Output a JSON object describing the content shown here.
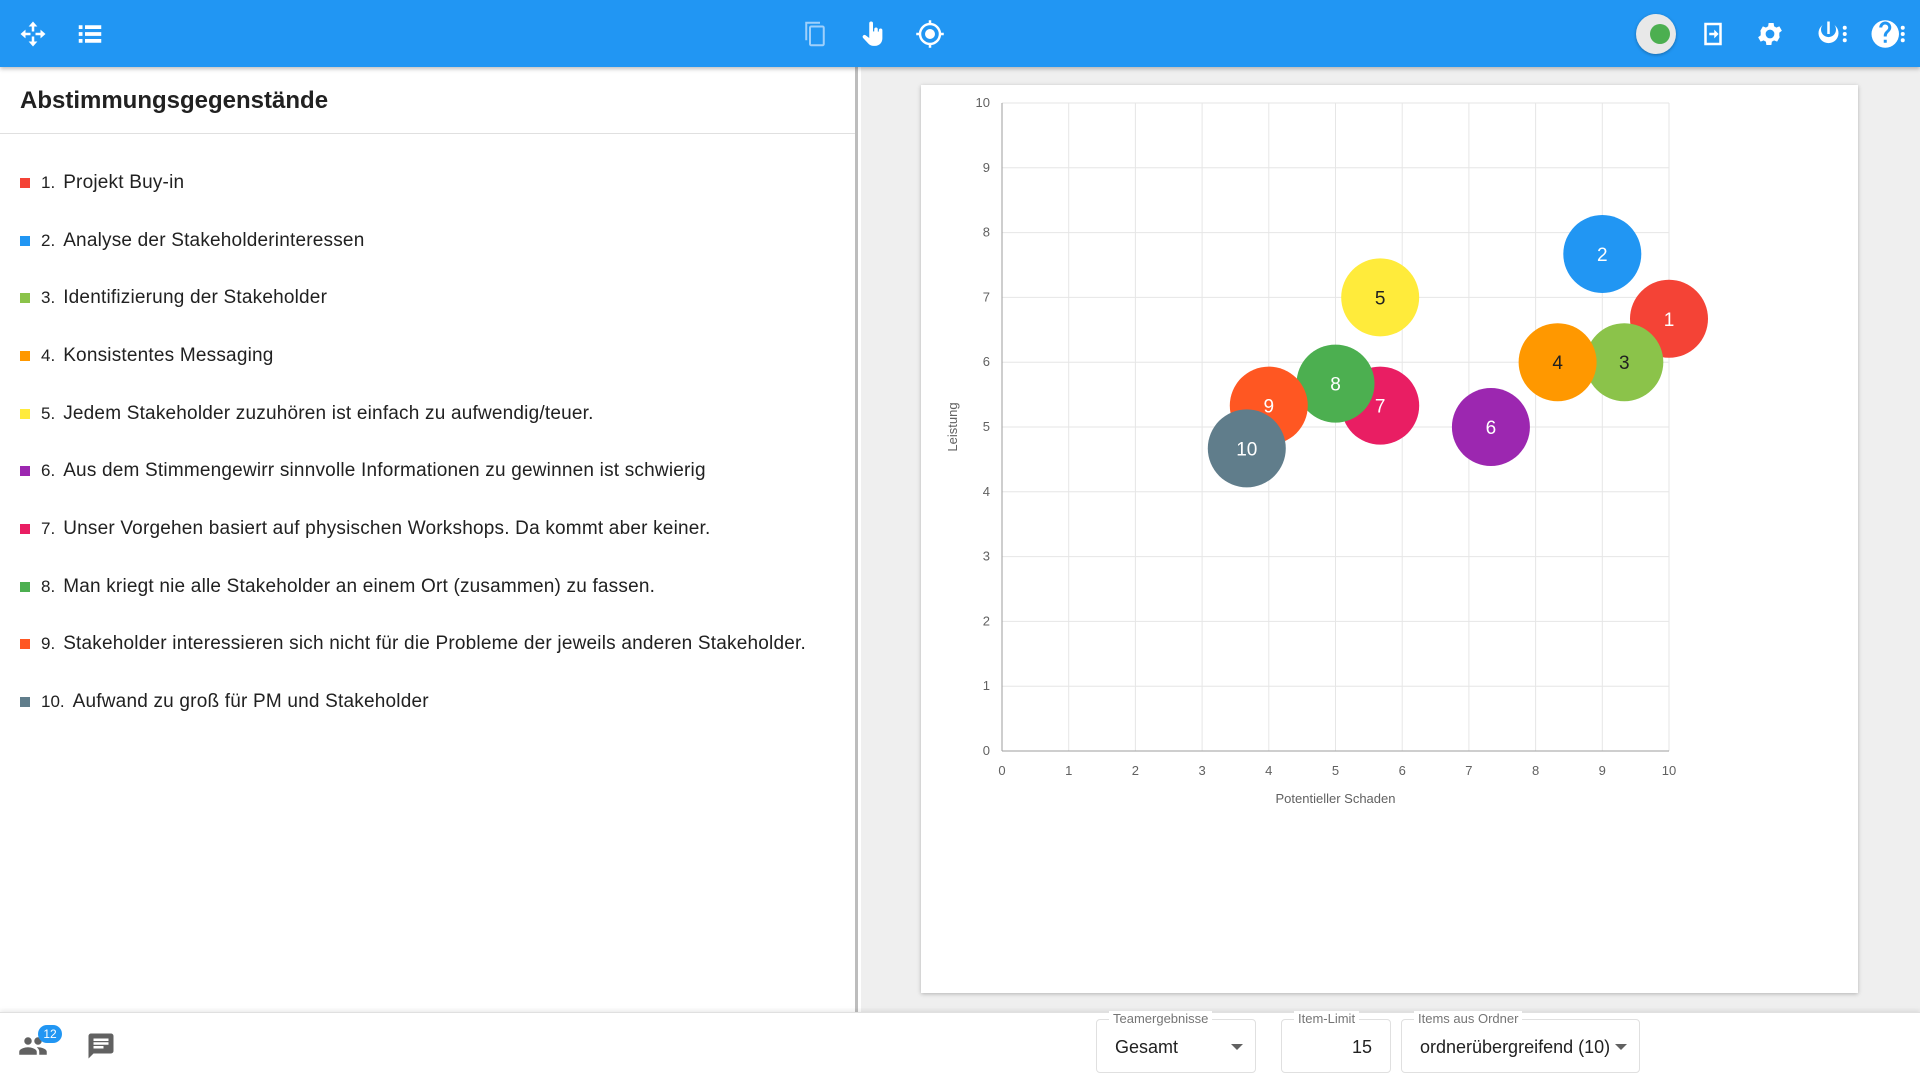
{
  "toolbar": {
    "left_icons": [
      "move-arrows-icon",
      "list-icon"
    ],
    "center_icons": [
      "copy-icon",
      "pointer-hand-icon",
      "target-icon"
    ],
    "right_icons": [
      "toggle-switch",
      "export-icon",
      "gear-icon",
      "power-menu-icon",
      "help-menu-icon"
    ],
    "accent_color": "#2196F3",
    "toggle_on_color": "#4CAF50"
  },
  "left_panel": {
    "title": "Abstimmungsgegenstände",
    "items": [
      {
        "num": "1.",
        "label": "Projekt Buy-in",
        "color": "#F44336"
      },
      {
        "num": "2.",
        "label": "Analyse der Stakeholderinteressen",
        "color": "#2196F3"
      },
      {
        "num": "3.",
        "label": "Identifizierung der Stakeholder",
        "color": "#8BC34A"
      },
      {
        "num": "4.",
        "label": "Konsistentes Messaging",
        "color": "#FF9800"
      },
      {
        "num": "5.",
        "label": "Jedem Stakeholder zuzuhören ist einfach zu aufwendig/teuer.",
        "color": "#FFEB3B"
      },
      {
        "num": "6.",
        "label": "Aus dem Stimmengewirr sinnvolle Informationen zu gewinnen ist schwierig",
        "color": "#9C27B0"
      },
      {
        "num": "7.",
        "label": "Unser Vorgehen basiert auf physischen Workshops. Da kommt aber keiner.",
        "color": "#E91E63"
      },
      {
        "num": "8.",
        "label": "Man kriegt nie alle Stakeholder an einem Ort (zusammen) zu fassen.",
        "color": "#4CAF50"
      },
      {
        "num": "9.",
        "label": "Stakeholder interessieren sich nicht für die Probleme der jeweils anderen Stakeholder.",
        "color": "#FF5722"
      },
      {
        "num": "10.",
        "label": "Aufwand zu groß für PM und Stakeholder",
        "color": "#607D8B"
      }
    ]
  },
  "chart_data": {
    "type": "scatter",
    "xlabel": "Potentieller Schaden",
    "ylabel": "Leistung",
    "xlim": [
      0,
      10
    ],
    "ylim": [
      0,
      10
    ],
    "xticks": [
      "0",
      "1",
      "2",
      "3",
      "4",
      "5",
      "6",
      "7",
      "8",
      "9",
      "10"
    ],
    "yticks": [
      "0",
      "1",
      "2",
      "3",
      "4",
      "5",
      "6",
      "7",
      "8",
      "9",
      "10"
    ],
    "grid": true,
    "points": [
      {
        "label": "1",
        "x": 10.0,
        "y": 6.67,
        "color": "#F44336",
        "text_color": "#ffffff"
      },
      {
        "label": "2",
        "x": 9.0,
        "y": 7.67,
        "color": "#2196F3",
        "text_color": "#ffffff"
      },
      {
        "label": "3",
        "x": 9.33,
        "y": 6.0,
        "color": "#8BC34A",
        "text_color": "#212121"
      },
      {
        "label": "4",
        "x": 8.33,
        "y": 6.0,
        "color": "#FF9800",
        "text_color": "#212121"
      },
      {
        "label": "5",
        "x": 5.67,
        "y": 7.0,
        "color": "#FFEB3B",
        "text_color": "#212121"
      },
      {
        "label": "6",
        "x": 7.33,
        "y": 5.0,
        "color": "#9C27B0",
        "text_color": "#ffffff"
      },
      {
        "label": "7",
        "x": 5.67,
        "y": 5.33,
        "color": "#E91E63",
        "text_color": "#ffffff"
      },
      {
        "label": "8",
        "x": 5.0,
        "y": 5.67,
        "color": "#4CAF50",
        "text_color": "#ffffff"
      },
      {
        "label": "9",
        "x": 4.0,
        "y": 5.33,
        "color": "#FF5722",
        "text_color": "#ffffff"
      },
      {
        "label": "10",
        "x": 3.67,
        "y": 4.67,
        "color": "#607D8B",
        "text_color": "#ffffff"
      }
    ]
  },
  "bottom_bar": {
    "participants_icon": "people-icon",
    "participants_count": "12",
    "chat_icon": "chat-icon",
    "team_results": {
      "legend": "Teamergebnisse",
      "value": "Gesamt"
    },
    "item_limit": {
      "legend": "Item-Limit",
      "value": "15"
    },
    "folder_items": {
      "legend": "Items aus Ordner",
      "value": "ordnerübergreifend (10)"
    }
  }
}
